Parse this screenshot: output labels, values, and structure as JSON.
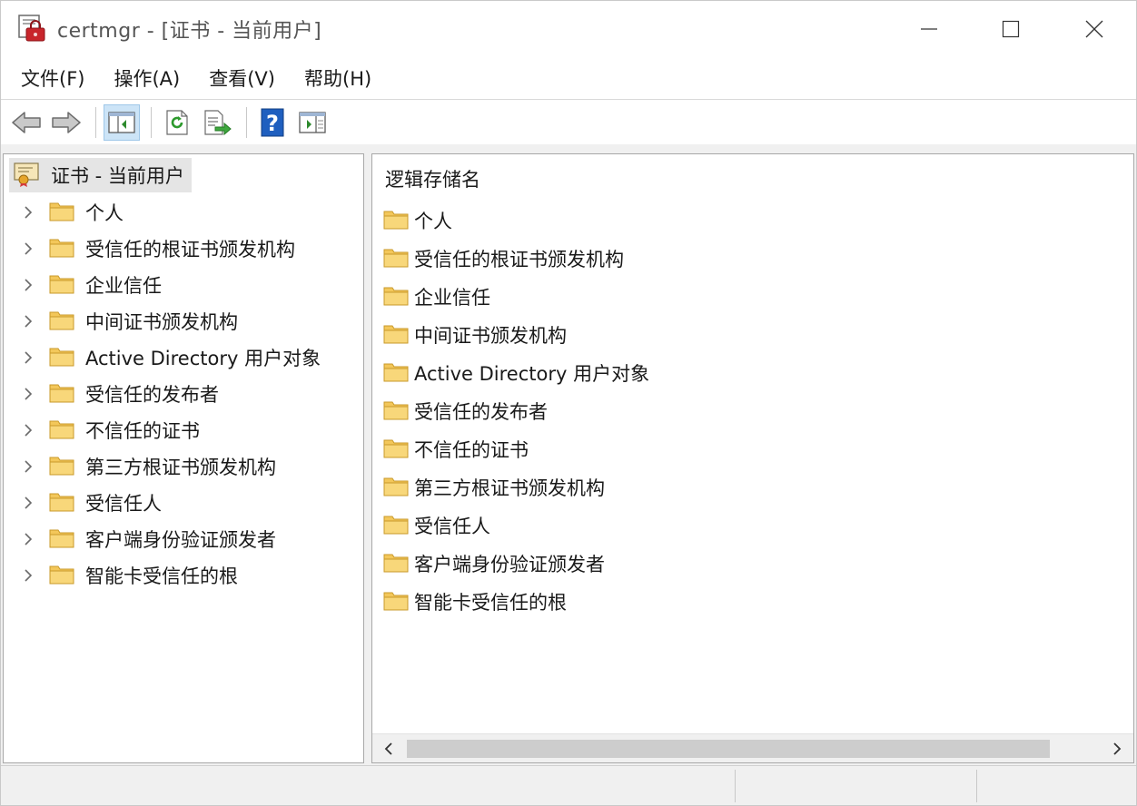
{
  "window": {
    "title": "certmgr - [证书 - 当前用户]"
  },
  "menu": [
    {
      "label": "文件(F)"
    },
    {
      "label": "操作(A)"
    },
    {
      "label": "查看(V)"
    },
    {
      "label": "帮助(H)"
    }
  ],
  "toolbar": {
    "icons": [
      "back-arrow-icon",
      "forward-arrow-icon",
      "show-hide-console-tree-icon",
      "refresh-icon",
      "export-list-icon",
      "help-icon",
      "action-pane-icon"
    ]
  },
  "tree": {
    "root_label": "证书 - 当前用户",
    "items": [
      {
        "label": "个人"
      },
      {
        "label": "受信任的根证书颁发机构"
      },
      {
        "label": "企业信任"
      },
      {
        "label": "中间证书颁发机构"
      },
      {
        "label": "Active Directory 用户对象"
      },
      {
        "label": "受信任的发布者"
      },
      {
        "label": "不信任的证书"
      },
      {
        "label": "第三方根证书颁发机构"
      },
      {
        "label": "受信任人"
      },
      {
        "label": "客户端身份验证颁发者"
      },
      {
        "label": "智能卡受信任的根"
      }
    ]
  },
  "list": {
    "column_header": "逻辑存储名",
    "items": [
      {
        "label": "个人"
      },
      {
        "label": "受信任的根证书颁发机构"
      },
      {
        "label": "企业信任"
      },
      {
        "label": "中间证书颁发机构"
      },
      {
        "label": "Active Directory 用户对象"
      },
      {
        "label": "受信任的发布者"
      },
      {
        "label": "不信任的证书"
      },
      {
        "label": "第三方根证书颁发机构"
      },
      {
        "label": "受信任人"
      },
      {
        "label": "客户端身份验证颁发者"
      },
      {
        "label": "智能卡受信任的根"
      }
    ]
  },
  "colors": {
    "folder": "#f3c75a",
    "selection": "#cce4f7",
    "help_blue": "#1f5fbf"
  }
}
